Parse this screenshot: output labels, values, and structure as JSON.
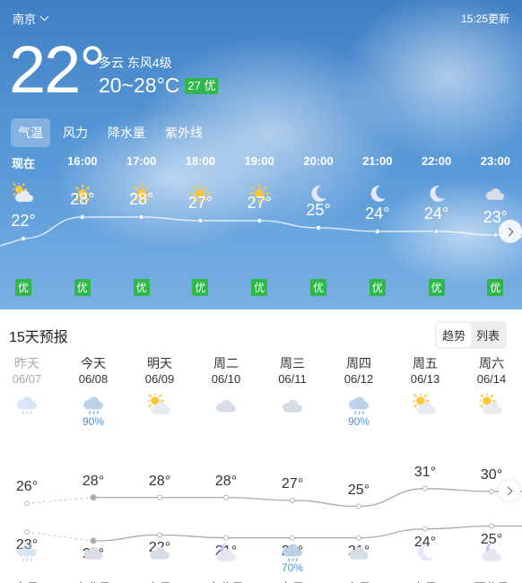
{
  "header": {
    "city": "南京",
    "update_time": "15:25更新"
  },
  "current": {
    "temp": "22°",
    "condition": "多云  东风4级",
    "range": "20~28°C",
    "aqi": "27 优"
  },
  "tabs": [
    "气温",
    "风力",
    "降水量",
    "紫外线"
  ],
  "hourly": [
    {
      "time": "现在",
      "icon": "partly-cloudy-sun-icon",
      "temp": "22°",
      "value": 22,
      "aqi": "优"
    },
    {
      "time": "16:00",
      "icon": "sun-icon",
      "temp": "28°",
      "value": 28,
      "aqi": "优"
    },
    {
      "time": "17:00",
      "icon": "sun-icon",
      "temp": "28°",
      "value": 28,
      "aqi": "优"
    },
    {
      "time": "18:00",
      "icon": "sun-icon",
      "temp": "27°",
      "value": 27,
      "aqi": "优"
    },
    {
      "time": "19:00",
      "icon": "sun-icon",
      "temp": "27°",
      "value": 27,
      "aqi": "优"
    },
    {
      "time": "20:00",
      "icon": "moon-icon",
      "temp": "25°",
      "value": 25,
      "aqi": "优"
    },
    {
      "time": "21:00",
      "icon": "moon-icon",
      "temp": "24°",
      "value": 24,
      "aqi": "优"
    },
    {
      "time": "22:00",
      "icon": "moon-icon",
      "temp": "24°",
      "value": 24,
      "aqi": "优"
    },
    {
      "time": "23:00",
      "icon": "cloud-icon",
      "temp": "23°",
      "value": 23,
      "aqi": "优"
    }
  ],
  "forecast": {
    "title": "15天预报",
    "toggle": [
      "趋势",
      "列表"
    ],
    "days": [
      {
        "name": "昨天",
        "date": "06/07",
        "icon": "rain-icon",
        "precip": "",
        "high": "26°",
        "high_v": 26,
        "low": "23°",
        "low_v": 23,
        "night_icon": "rain-icon",
        "night_precip": "",
        "wind": "东风",
        "past": true
      },
      {
        "name": "今天",
        "date": "06/08",
        "icon": "rain-icon",
        "precip": "90%",
        "high": "28°",
        "high_v": 28,
        "low": "20°",
        "low_v": 20,
        "night_icon": "cloud-icon",
        "night_precip": "",
        "wind": "东北风",
        "past": false
      },
      {
        "name": "明天",
        "date": "06/09",
        "icon": "partly-cloudy-sun-icon",
        "precip": "",
        "high": "28°",
        "high_v": 28,
        "low": "22°",
        "low_v": 22,
        "night_icon": "cloud-icon",
        "night_precip": "",
        "wind": "东风",
        "past": false
      },
      {
        "name": "周二",
        "date": "06/10",
        "icon": "cloud-icon",
        "precip": "",
        "high": "28°",
        "high_v": 28,
        "low": "21°",
        "low_v": 21,
        "night_icon": "moon-cloud-icon",
        "night_precip": "",
        "wind": "东北风",
        "past": false
      },
      {
        "name": "周三",
        "date": "06/11",
        "icon": "cloud-icon",
        "precip": "",
        "high": "27°",
        "high_v": 27,
        "low": "21°",
        "low_v": 21,
        "night_icon": "rain-icon",
        "night_precip": "70%",
        "wind": "东风",
        "past": false
      },
      {
        "name": "周四",
        "date": "06/12",
        "icon": "rain-icon",
        "precip": "90%",
        "high": "25°",
        "high_v": 25,
        "low": "21°",
        "low_v": 21,
        "night_icon": "cloud-icon",
        "night_precip": "",
        "wind": "东风",
        "past": false
      },
      {
        "name": "周五",
        "date": "06/13",
        "icon": "partly-cloudy-sun-icon",
        "precip": "",
        "high": "31°",
        "high_v": 31,
        "low": "24°",
        "low_v": 24,
        "night_icon": "moon-icon",
        "night_precip": "",
        "wind": "东风",
        "past": false
      },
      {
        "name": "周六",
        "date": "06/14",
        "icon": "partly-cloudy-sun-icon",
        "precip": "",
        "high": "30°",
        "high_v": 30,
        "low": "25°",
        "low_v": 25,
        "night_icon": "moon-cloud-icon",
        "night_precip": "",
        "wind": "西北风",
        "past": false
      }
    ]
  },
  "colors": {
    "aqi_green": "#2fb84a",
    "precip_blue": "#4a90d9"
  }
}
